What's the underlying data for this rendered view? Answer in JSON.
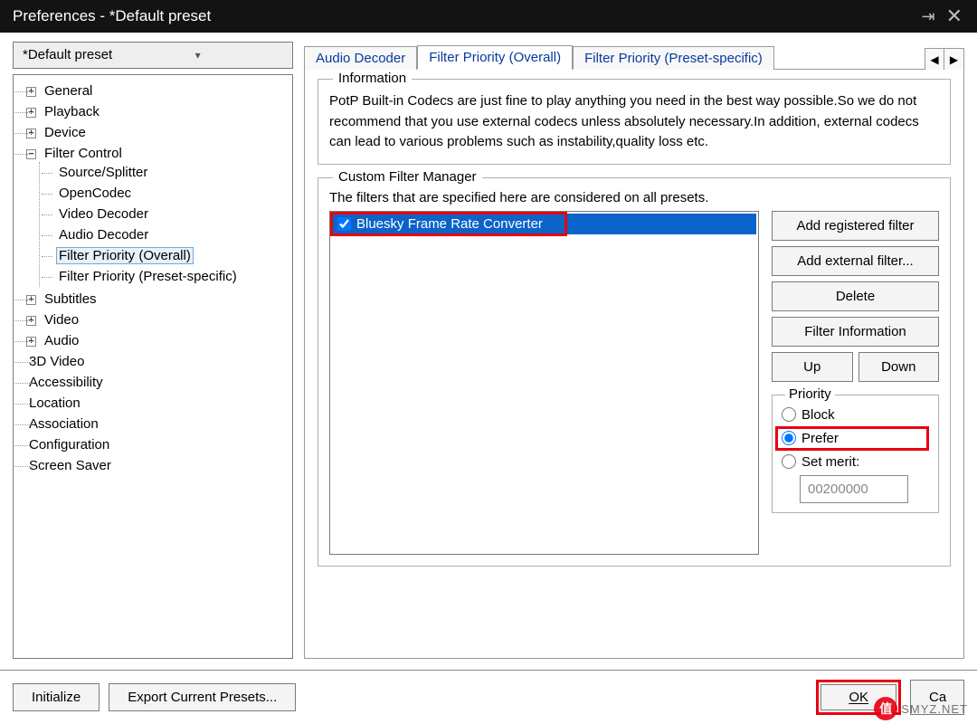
{
  "window": {
    "title": "Preferences - *Default preset"
  },
  "preset": {
    "selected": "*Default preset"
  },
  "tree": {
    "nodes": {
      "general": "General",
      "playback": "Playback",
      "device": "Device",
      "filter_control": "Filter Control",
      "source_splitter": "Source/Splitter",
      "opencodec": "OpenCodec",
      "video_decoder": "Video Decoder",
      "audio_decoder": "Audio Decoder",
      "filter_priority_overall": "Filter Priority (Overall)",
      "filter_priority_preset": "Filter Priority (Preset-specific)",
      "subtitles": "Subtitles",
      "video": "Video",
      "audio": "Audio",
      "three_d": "3D Video",
      "accessibility": "Accessibility",
      "location": "Location",
      "association": "Association",
      "configuration": "Configuration",
      "screen_saver": "Screen Saver"
    }
  },
  "tabs": {
    "audio_decoder": "Audio Decoder",
    "filter_priority_overall": "Filter Priority (Overall)",
    "filter_priority_preset": "Filter Priority (Preset-specific)"
  },
  "info": {
    "legend": "Information",
    "text": "PotP Built-in Codecs are just fine to play anything you need in the best way possible.So we do not recommend that you use external codecs unless absolutely necessary.In addition, external codecs can lead to various problems such as instability,quality loss etc."
  },
  "cfm": {
    "legend": "Custom Filter Manager",
    "desc": "The filters that are specified here are considered on all presets.",
    "filters": {
      "item0": {
        "label": "Bluesky Frame Rate Converter",
        "checked": true
      }
    },
    "buttons": {
      "add_registered": "Add registered filter",
      "add_external": "Add external filter...",
      "delete": "Delete",
      "filter_info": "Filter Information",
      "up": "Up",
      "down": "Down"
    },
    "priority": {
      "legend": "Priority",
      "block": "Block",
      "prefer": "Prefer",
      "set_merit": "Set merit:",
      "merit_value": "00200000",
      "selected": "prefer"
    }
  },
  "footer": {
    "initialize": "Initialize",
    "export": "Export Current Presets...",
    "ok": "OK",
    "cancel": "Cancel"
  },
  "watermark": {
    "badge": "值",
    "text": "SMYZ.NET"
  }
}
